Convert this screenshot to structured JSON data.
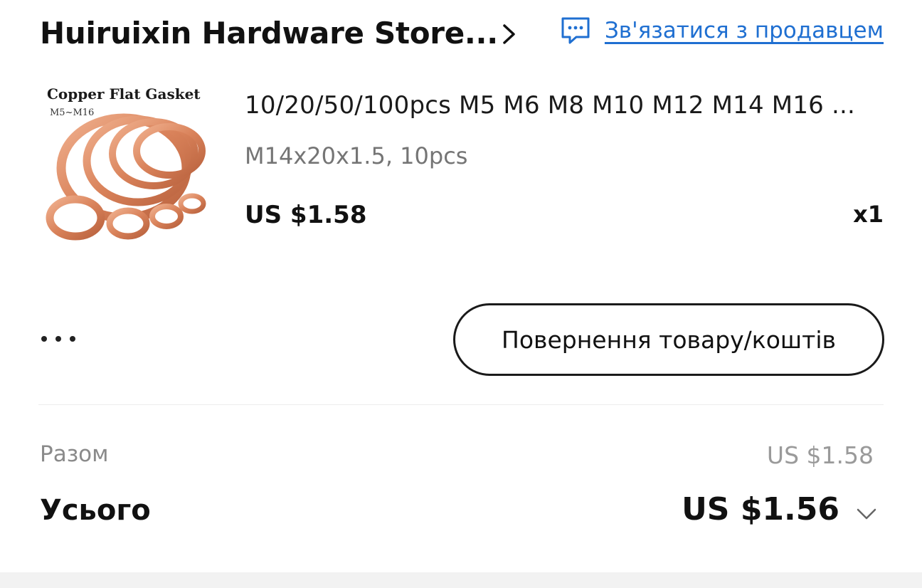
{
  "store": {
    "name": "Huiruixin Hardware Store...",
    "contact_label": "Зв'язатися з продавцем",
    "chevron_icon": "chevron-right-icon",
    "contact_icon": "chat-bubble-icon"
  },
  "product": {
    "image_title": "Copper Flat Gasket",
    "image_subtitle": "M5~M16",
    "title": "10/20/50/100pcs M5 M6 M8 M10 M12 M14 M16 ...",
    "variant": "M14x20x1.5, 10pcs",
    "price": "US $1.58",
    "quantity": "x1"
  },
  "actions": {
    "more_label": "...",
    "return_label": "Повернення товару/коштів"
  },
  "totals": {
    "subtotal_label": "Разом",
    "subtotal_value": "US $1.58",
    "total_label": "Усього",
    "total_value": "US $1.56",
    "expand_icon": "chevron-down-icon"
  },
  "colors": {
    "link": "#1f6fd1",
    "copper": "#d98a64",
    "text": "#111111",
    "muted": "#8a8a8a"
  }
}
